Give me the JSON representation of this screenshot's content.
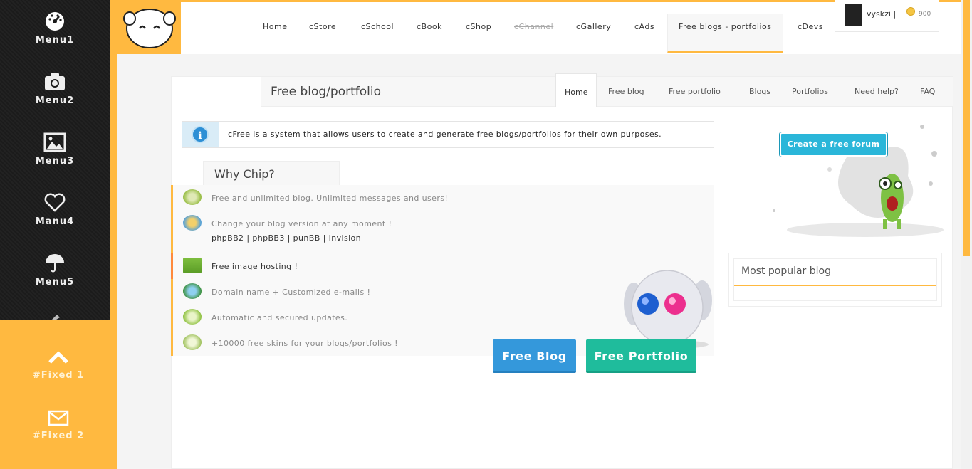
{
  "sidebar": {
    "items": [
      {
        "label": "Menu1",
        "icon": "dashboard-icon"
      },
      {
        "label": "Menu2",
        "icon": "camera-icon"
      },
      {
        "label": "Menu3",
        "icon": "image-icon"
      },
      {
        "label": "Manu4",
        "icon": "heart-icon"
      },
      {
        "label": "Menu5",
        "icon": "umbrella-icon"
      }
    ],
    "fixed": [
      {
        "label": "#Fixed 1",
        "icon": "chevron-up-icon"
      },
      {
        "label": "#Fixed 2",
        "icon": "envelope-icon"
      }
    ]
  },
  "header": {
    "nav": [
      {
        "label": "Home"
      },
      {
        "label": "cStore"
      },
      {
        "label": "cSchool"
      },
      {
        "label": "cBook"
      },
      {
        "label": "cShop"
      },
      {
        "label": "cChannel"
      },
      {
        "label": "cGallery"
      },
      {
        "label": "cAds"
      },
      {
        "label": "Free blogs - portfolios"
      },
      {
        "label": "cDevs"
      }
    ],
    "user": {
      "name": "vyskzi",
      "separator": "|",
      "coins": "900"
    }
  },
  "page": {
    "title": "Free blog/portfolio",
    "tabs": [
      {
        "label": "Home"
      },
      {
        "label": "Free blog"
      },
      {
        "label": "Free portfolio"
      },
      {
        "label": "Blogs"
      },
      {
        "label": "Portfolios"
      },
      {
        "label": "Need help?"
      },
      {
        "label": "FAQ"
      }
    ],
    "info": "cFree is a system that allows users to create and generate free blogs/portfolios for their own purposes.",
    "why_title": "Why Chip?",
    "features": [
      {
        "text": "Free and unlimited blog. Unlimited messages and users!"
      },
      {
        "text": "Change your blog version at any moment !"
      },
      {
        "text": "phpBB2 | phpBB3 | punBB | Invision"
      },
      {
        "text": "Free image hosting !"
      },
      {
        "text": "Domain name + Customized e-mails !"
      },
      {
        "text": "Automatic and secured updates."
      },
      {
        "text": "+10000 free skins for your blogs/portfolios !"
      }
    ],
    "buttons": {
      "blog": "Free Blog",
      "portfolio": "Free Portfolio"
    },
    "forum_button": "Create a free forum",
    "popular_title": "Most popular blog"
  },
  "colors": {
    "accent": "#ffb940",
    "blue": "#3498db",
    "teal": "#1fbc9c",
    "sidebar": "#1b1b1b"
  }
}
